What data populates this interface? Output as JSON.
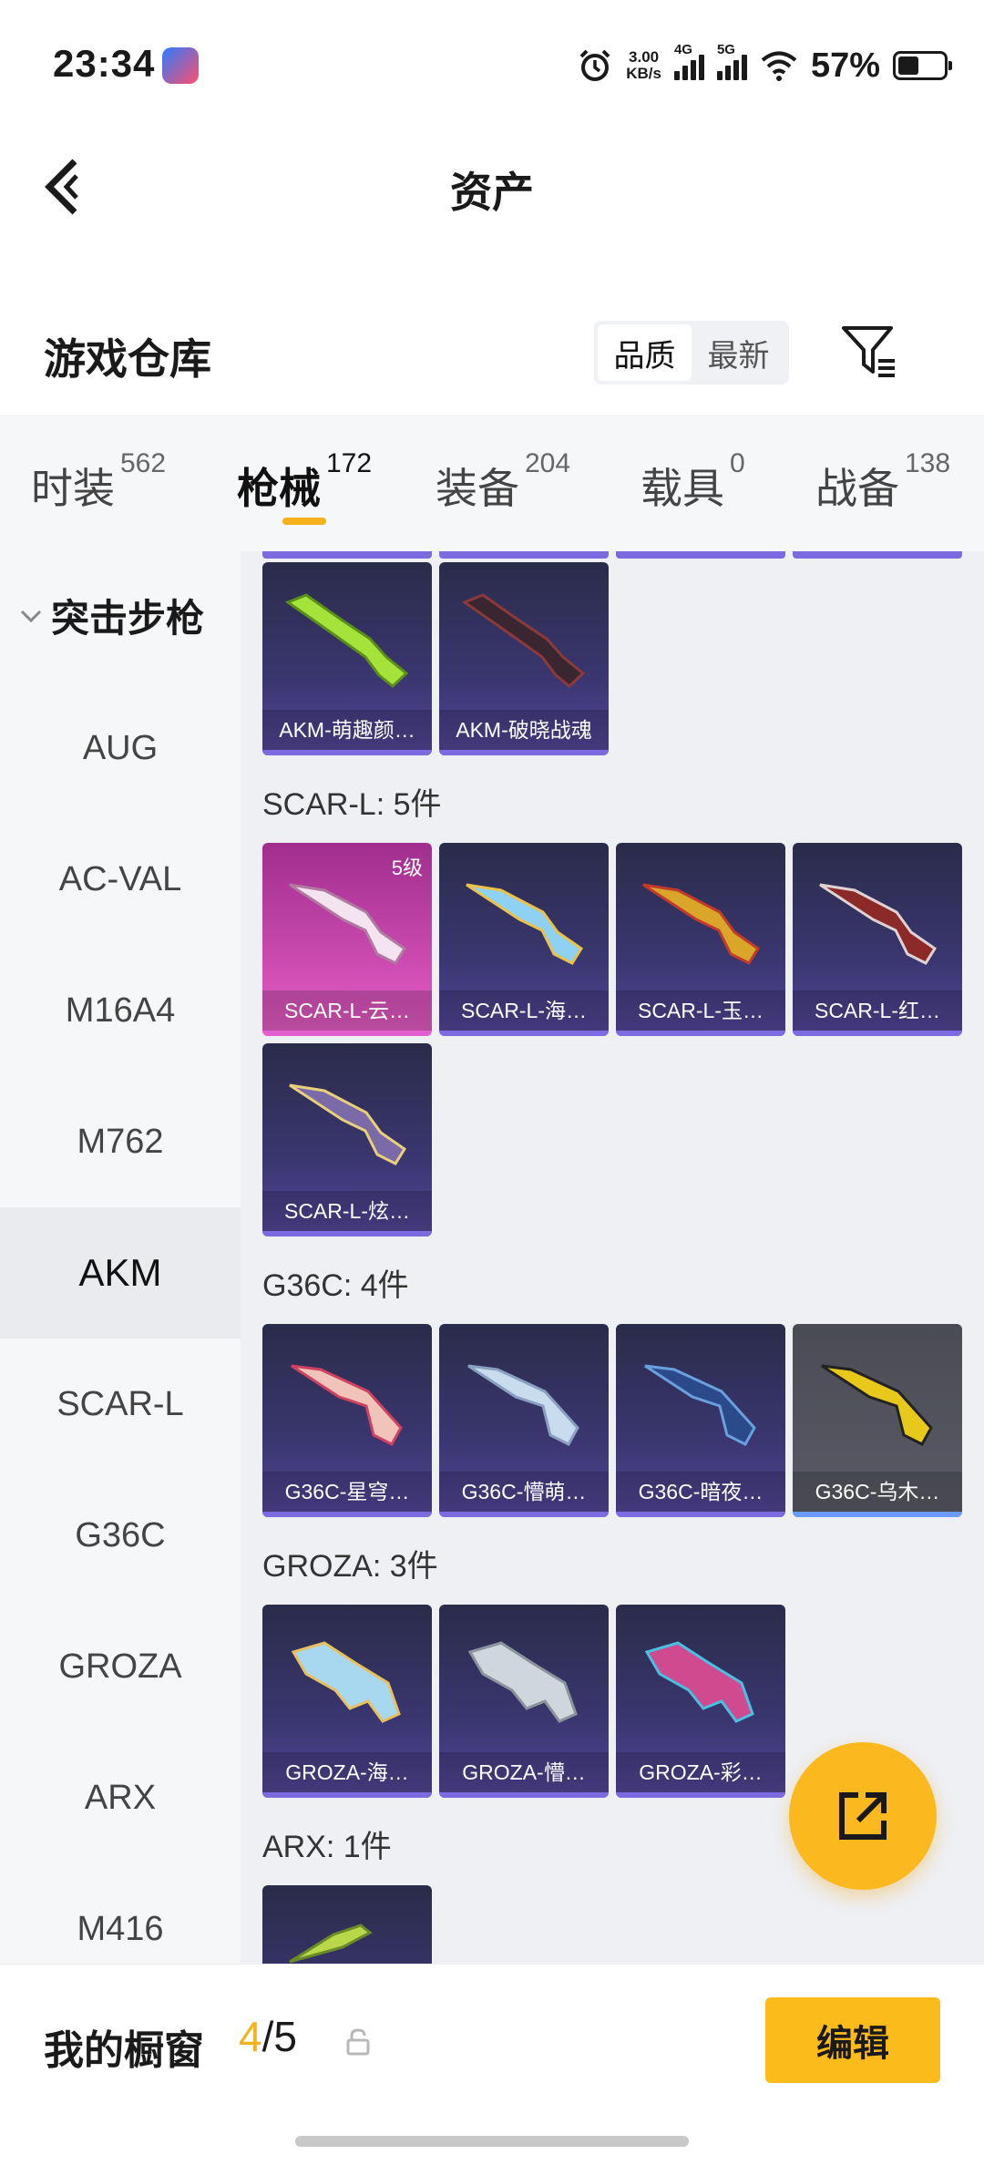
{
  "status_bar": {
    "time": "23:34",
    "net_speed_top": "3.00",
    "net_speed_bottom": "KB/s",
    "signal1": "4G",
    "signal2": "5G",
    "battery": "57%",
    "icons": [
      "alarm-icon",
      "signal-icon",
      "wifi-icon",
      "battery-icon"
    ]
  },
  "header": {
    "title": "资产",
    "back_icon": "back-arrow-icon"
  },
  "section": {
    "title": "游戏仓库",
    "sort_options": [
      "品质",
      "最新"
    ],
    "sort_selected": "品质",
    "filter_icon": "filter-icon"
  },
  "tabs": [
    {
      "label": "时装",
      "count": "562"
    },
    {
      "label": "枪械",
      "count": "172",
      "active": true
    },
    {
      "label": "装备",
      "count": "204"
    },
    {
      "label": "载具",
      "count": "0"
    },
    {
      "label": "战备",
      "count": "138"
    }
  ],
  "sidenav": {
    "group": "突击步枪",
    "items": [
      "AUG",
      "AC-VAL",
      "M16A4",
      "M762",
      "AKM",
      "SCAR-L",
      "G36C",
      "GROZA",
      "ARX",
      "M416"
    ],
    "active": "AKM"
  },
  "groups": {
    "akm": {
      "items": [
        "AKM-萌趣颜…",
        "AKM-破晓战魂"
      ]
    },
    "scar": {
      "label": "SCAR-L: 5件",
      "items": [
        "SCAR-L-云…",
        "SCAR-L-海…",
        "SCAR-L-玉…",
        "SCAR-L-红…",
        "SCAR-L-炫…"
      ],
      "first_level": "5级"
    },
    "g36c": {
      "label": "G36C: 4件",
      "items": [
        "G36C-星穹…",
        "G36C-懵萌…",
        "G36C-暗夜…",
        "G36C-乌木…"
      ]
    },
    "groza": {
      "label": "GROZA: 3件",
      "items": [
        "GROZA-海…",
        "GROZA-懵…",
        "GROZA-彩…"
      ]
    },
    "arx": {
      "label": "ARX: 1件"
    }
  },
  "fab": {
    "icon": "share-icon"
  },
  "bottom": {
    "title": "我的橱窗",
    "current": "4",
    "total": "/5",
    "lock_icon": "lock-icon",
    "edit_label": "编辑"
  }
}
